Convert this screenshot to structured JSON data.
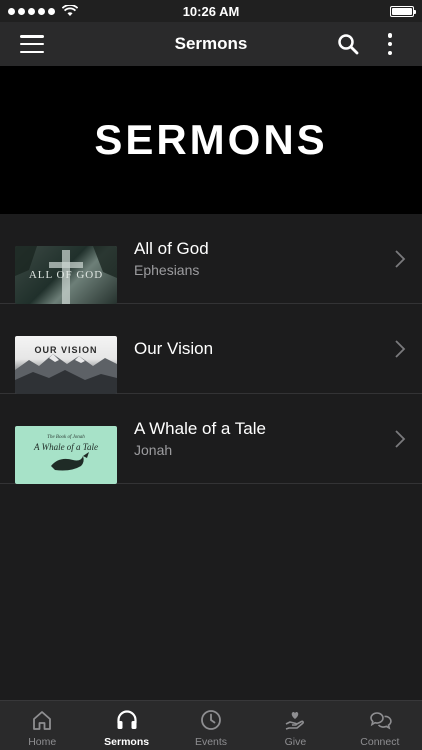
{
  "status_bar": {
    "time": "10:26 AM"
  },
  "nav": {
    "title": "Sermons"
  },
  "hero": {
    "title": "SERMONS"
  },
  "sermons": [
    {
      "title": "All of God",
      "subtitle": "Ephesians",
      "thumb_text": "ALL OF GOD"
    },
    {
      "title": "Our Vision",
      "subtitle": "",
      "thumb_text": "OUR VISION"
    },
    {
      "title": "A Whale of a Tale",
      "subtitle": "Jonah",
      "thumb_top": "The Book of Jonah",
      "thumb_text": "A Whale of a Tale"
    }
  ],
  "tabs": [
    {
      "label": "Home",
      "icon": "home-icon"
    },
    {
      "label": "Sermons",
      "icon": "headphones-icon"
    },
    {
      "label": "Events",
      "icon": "clock-icon"
    },
    {
      "label": "Give",
      "icon": "hand-heart-icon"
    },
    {
      "label": "Connect",
      "icon": "chat-bubbles-icon"
    }
  ],
  "colors": {
    "hero_bg": "#000000",
    "list_bg": "#1c1c1d",
    "nav_bg": "#2a2a2b",
    "subtitle": "#9c9c9f",
    "tab_inactive": "#8e8e91"
  }
}
